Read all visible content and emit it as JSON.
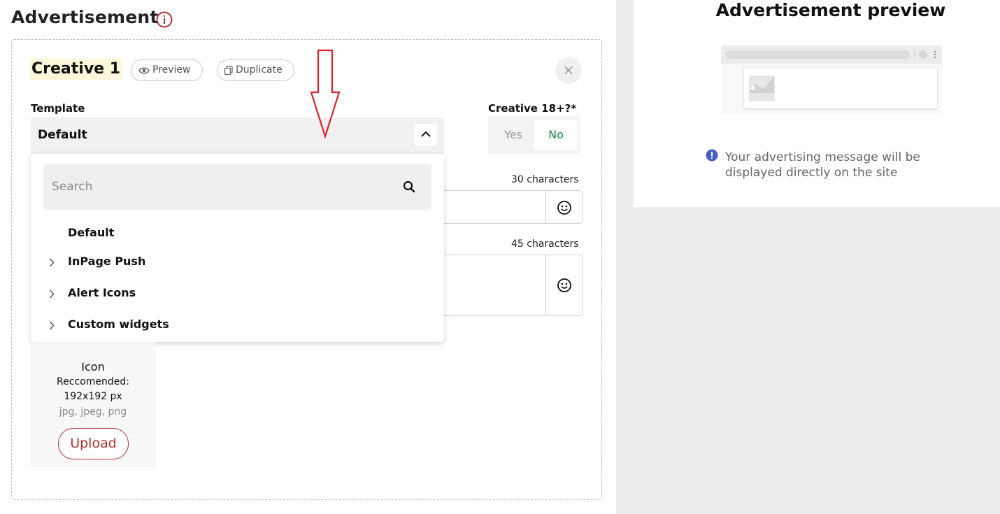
{
  "header": {
    "title": "Advertisement",
    "info_icon": "info-circle-icon",
    "accent_color": "#b3322e"
  },
  "creative": {
    "title": "Creative 1",
    "preview_label": "Preview",
    "duplicate_label": "Duplicate",
    "close_label": "×"
  },
  "template": {
    "label": "Template",
    "selected": "Default",
    "dropdown": {
      "search_placeholder": "Search",
      "items": [
        {
          "label": "Default",
          "has_children": false
        },
        {
          "label": "InPage Push",
          "has_children": true
        },
        {
          "label": "Alert Icons",
          "has_children": true
        },
        {
          "label": "Custom widgets",
          "has_children": true
        }
      ]
    }
  },
  "adult": {
    "label": "Creative 18+?*",
    "yes_label": "Yes",
    "no_label": "No",
    "selected": "No",
    "selected_color": "#138a3a"
  },
  "fields": {
    "title_limit": "30 characters",
    "description_limit": "45 characters"
  },
  "icon_upload": {
    "title": "Icon",
    "recommended": "Reccomended:",
    "size": "192x192 px",
    "types": "jpg, jpeg, png",
    "button": "Upload"
  },
  "preview": {
    "title": "Advertisement preview",
    "notice": "Your advertising message will be displayed directly on the site",
    "notice_icon_color": "#4a5fc1"
  }
}
